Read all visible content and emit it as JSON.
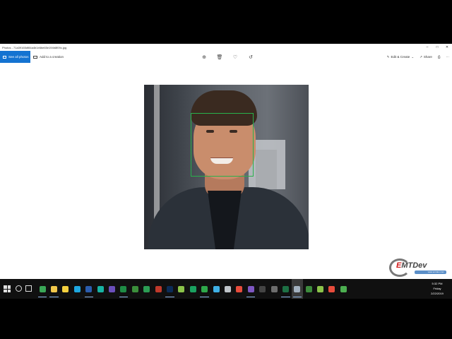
{
  "window": {
    "title": "Photos - 71a39165df84a4b1e6be65e194b8f09c.jpg",
    "controls": [
      "minimize",
      "maximize",
      "close"
    ]
  },
  "toolbar": {
    "see_all_photos": "See all photos",
    "add_to_creation": "Add to a creation",
    "center_actions": [
      "zoom-icon",
      "delete-icon",
      "favorite-heart-icon",
      "rotate-icon"
    ],
    "edit_create": "Edit & Create",
    "share": "Share",
    "print_icon": "printer-icon",
    "more_icon": "more-icon"
  },
  "overlay": {
    "logo_text_red": "E",
    "logo_text": "MTDev",
    "logo_tagline": "www.emtdev.com"
  },
  "taskbar": {
    "apps": [
      {
        "name": "chrome",
        "color": "#3aa757",
        "active": true
      },
      {
        "name": "file-explorer",
        "color": "#f2c84b",
        "active": true
      },
      {
        "name": "notes",
        "color": "#f4d03f",
        "active": false
      },
      {
        "name": "skype",
        "color": "#1ea7e0",
        "active": false
      },
      {
        "name": "word",
        "color": "#2b5dae",
        "active": true
      },
      {
        "name": "ribbon",
        "color": "#17b3a3",
        "active": false
      },
      {
        "name": "media",
        "color": "#6b4fbb",
        "active": false
      },
      {
        "name": "excel",
        "color": "#1e8c45",
        "active": true
      },
      {
        "name": "maps",
        "color": "#3b8f3b",
        "active": false
      },
      {
        "name": "sheets",
        "color": "#2c9d54",
        "active": false
      },
      {
        "name": "app-11",
        "color": "#c0392b",
        "active": false
      },
      {
        "name": "photoshop",
        "color": "#0b2c58",
        "active": true
      },
      {
        "name": "android",
        "color": "#8bc34a",
        "active": false
      },
      {
        "name": "app-14",
        "color": "#1aa160",
        "active": false
      },
      {
        "name": "camtasia",
        "color": "#2ea84a",
        "active": true
      },
      {
        "name": "mobizen",
        "color": "#3fb0e5",
        "active": false
      },
      {
        "name": "cloud",
        "color": "#bfc4c9",
        "active": false
      },
      {
        "name": "record",
        "color": "#e74c3c",
        "active": false
      },
      {
        "name": "visual-studio",
        "color": "#7e57c2",
        "active": true
      },
      {
        "name": "terminal",
        "color": "#444444",
        "active": false
      },
      {
        "name": "calculator",
        "color": "#6d6d6d",
        "active": false
      },
      {
        "name": "excel-2",
        "color": "#1d7044",
        "active": true
      },
      {
        "name": "photos",
        "color": "#a3b1bf",
        "active": true,
        "current": true
      },
      {
        "name": "app-24",
        "color": "#3d8b3d",
        "active": false
      },
      {
        "name": "vim",
        "color": "#8bc34a",
        "active": false
      },
      {
        "name": "app-26",
        "color": "#e74c3c",
        "active": false
      },
      {
        "name": "app-27",
        "color": "#4caf50",
        "active": false
      }
    ],
    "time": "5:32 PM",
    "day": "Friday",
    "date": "2/22/2019"
  }
}
